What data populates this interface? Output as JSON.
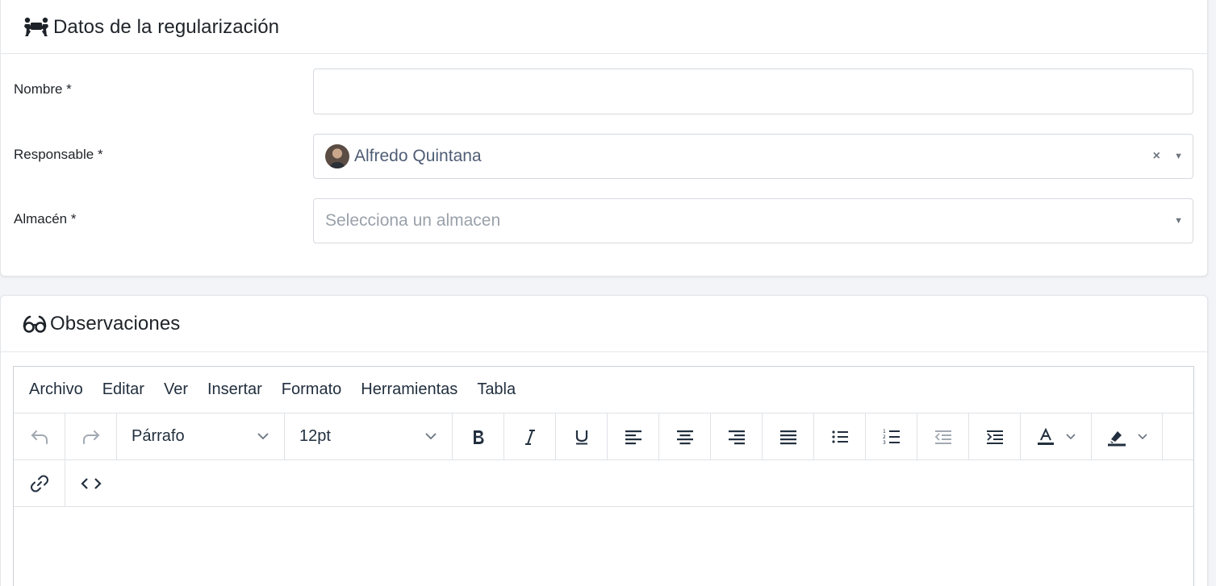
{
  "section1": {
    "title": "Datos de la regularización",
    "icon": "people-carry-icon",
    "fields": {
      "nombre": {
        "label": "Nombre *",
        "value": "",
        "placeholder": ""
      },
      "responsable": {
        "label": "Responsable *",
        "value": "Alfredo Quintana",
        "clear": "×",
        "caret": "▼"
      },
      "almacen": {
        "label": "Almacén *",
        "placeholder": "Selecciona un almacen",
        "caret": "▼"
      }
    }
  },
  "section2": {
    "title": "Observaciones",
    "icon": "glasses-icon",
    "editor": {
      "menu": [
        "Archivo",
        "Editar",
        "Ver",
        "Insertar",
        "Formato",
        "Herramientas",
        "Tabla"
      ],
      "block_format": "Párrafo",
      "font_size": "12pt",
      "content": ""
    }
  },
  "colors": {
    "page_bg": "#f2f4f7",
    "card_bg": "#ffffff",
    "border": "#d5d9de",
    "text": "#1e2329",
    "select_value": "#4f5d75",
    "placeholder": "#9aa1aa",
    "toolbar_icon": "#222f3e",
    "toolbar_icon_disabled": "#a2a9b1"
  }
}
